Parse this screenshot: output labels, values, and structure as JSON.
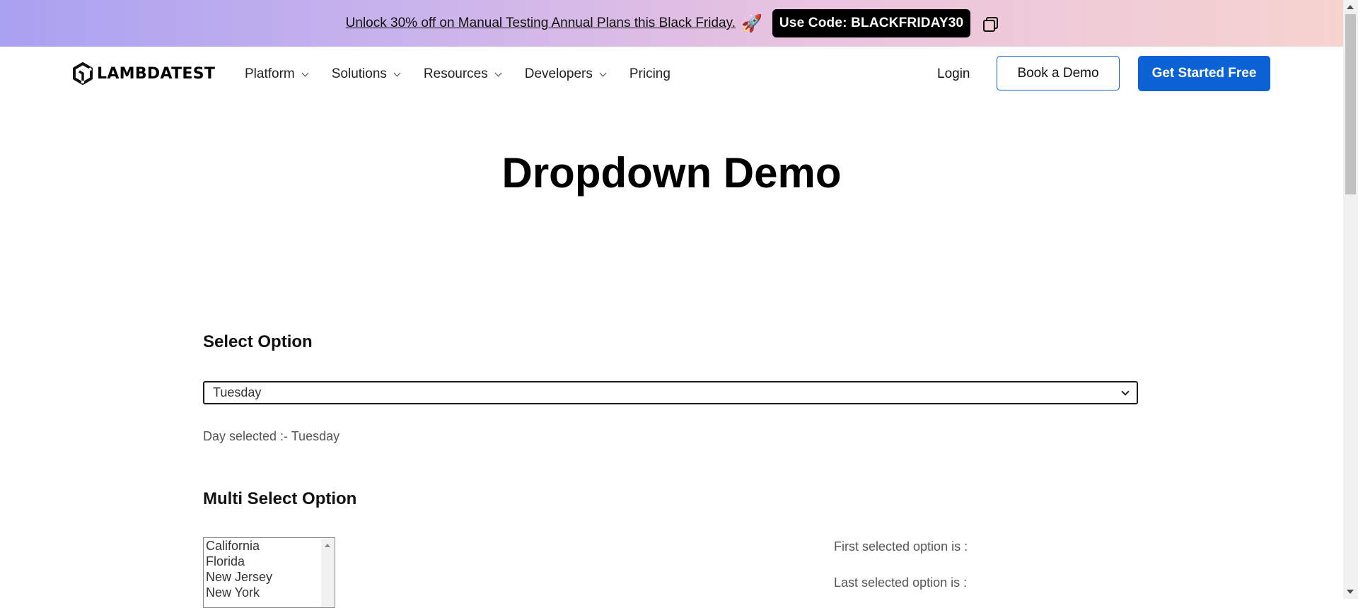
{
  "promo": {
    "text": "Unlock 30% off on Manual Testing Annual Plans this Black Friday.",
    "rocket": "🚀",
    "code": "Use Code: BLACKFRIDAY30"
  },
  "header": {
    "logo_text": "LAMBDATEST",
    "nav": [
      "Platform",
      "Solutions",
      "Resources",
      "Developers",
      "Pricing"
    ],
    "login": "Login",
    "book_demo": "Book a Demo",
    "get_started": "Get Started Free",
    "brand_color": "#0b63d6"
  },
  "main": {
    "title": "Dropdown Demo",
    "select_option": {
      "heading": "Select Option",
      "selected": "Tuesday",
      "result": "Day selected :- Tuesday"
    },
    "multi_select": {
      "heading": "Multi Select Option",
      "options": [
        "California",
        "Florida",
        "New Jersey",
        "New York"
      ],
      "first_selected": "First selected option is :",
      "last_selected": "Last selected option is :"
    }
  }
}
